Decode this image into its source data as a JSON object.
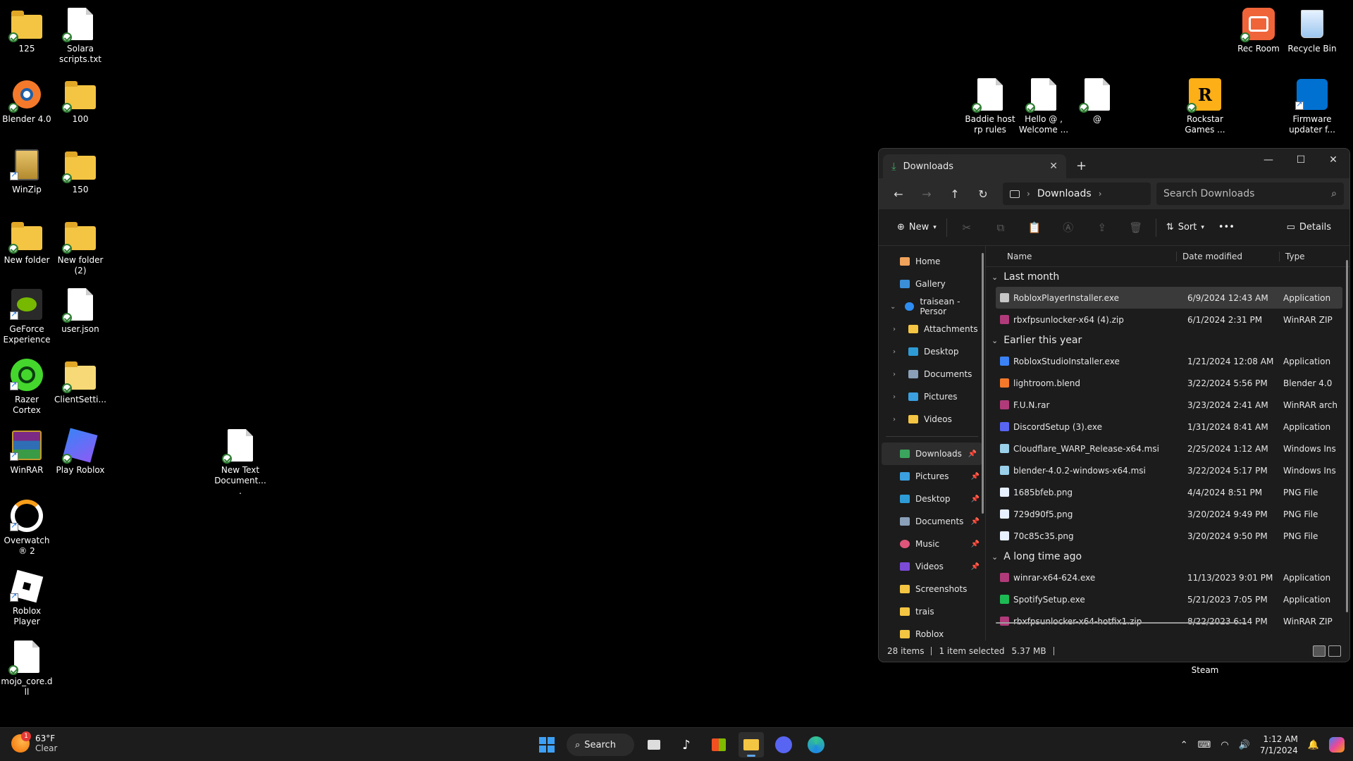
{
  "desktop": {
    "icons": {
      "i125": "125",
      "solara": "Solara scripts.txt",
      "blender": "Blender 4.0",
      "i100": "100",
      "winzip": "WinZip",
      "i150": "150",
      "newfolder": "New folder",
      "newfolder2": "New folder (2)",
      "geforce": "GeForce Experience",
      "userjson": "user.json",
      "razer": "Razer Cortex",
      "clientsetti": "ClientSetti...",
      "winrar": "WinRAR",
      "playroblox": "Play Roblox",
      "newtext": "New Text Document....",
      "overwatch": "Overwatch® 2",
      "robloxplayer": "Roblox Player",
      "mojo": "mojo_core.dll",
      "recroom": "Rec Room",
      "recycle": "Recycle Bin",
      "baddie": "Baddie host rp rules",
      "hello": "Hello @ , Welcome ...",
      "at": "@",
      "rockstar": "Rockstar Games ...",
      "firmware": "Firmware updater f...",
      "steam": "Steam"
    }
  },
  "explorer": {
    "tab_title": "Downloads",
    "breadcrumb": "Downloads",
    "search_placeholder": "Search Downloads",
    "toolbar": {
      "new": "New",
      "sort": "Sort",
      "more": "•••",
      "details": "Details"
    },
    "nav": {
      "home": "Home",
      "gallery": "Gallery",
      "onedrive": "traisean - Persor",
      "attachments": "Attachments",
      "desktop": "Desktop",
      "documents": "Documents",
      "pictures": "Pictures",
      "videos": "Videos",
      "q_downloads": "Downloads",
      "q_pictures": "Pictures",
      "q_desktop": "Desktop",
      "q_documents": "Documents",
      "q_music": "Music",
      "q_videos": "Videos",
      "q_screenshots": "Screenshots",
      "q_trais": "trais",
      "q_roblox": "Roblox"
    },
    "columns": {
      "name": "Name",
      "date": "Date modified",
      "type": "Type"
    },
    "groups": {
      "g1": "Last month",
      "g2": "Earlier this year",
      "g3": "A long time ago"
    },
    "files": [
      {
        "name": "RobloxPlayerInstaller.exe",
        "date": "6/9/2024 12:43 AM",
        "type": "Application",
        "color": "#c7c7c7"
      },
      {
        "name": "rbxfpsunlocker-x64 (4).zip",
        "date": "6/1/2024 2:31 PM",
        "type": "WinRAR ZIP",
        "color": "#b03a7a"
      },
      {
        "name": "RobloxStudioInstaller.exe",
        "date": "1/21/2024 12:08 AM",
        "type": "Application",
        "color": "#3b82f6"
      },
      {
        "name": "lightroom.blend",
        "date": "3/22/2024 5:56 PM",
        "type": "Blender 4.0",
        "color": "#f5792a"
      },
      {
        "name": "F.U.N.rar",
        "date": "3/23/2024 2:41 AM",
        "type": "WinRAR arch",
        "color": "#b03a7a"
      },
      {
        "name": "DiscordSetup (3).exe",
        "date": "1/31/2024 8:41 AM",
        "type": "Application",
        "color": "#5865f2"
      },
      {
        "name": "Cloudflare_WARP_Release-x64.msi",
        "date": "2/25/2024 1:12 AM",
        "type": "Windows Ins",
        "color": "#9ad0ea"
      },
      {
        "name": "blender-4.0.2-windows-x64.msi",
        "date": "3/22/2024 5:17 PM",
        "type": "Windows Ins",
        "color": "#9ad0ea"
      },
      {
        "name": "1685bfeb.png",
        "date": "4/4/2024 8:51 PM",
        "type": "PNG File",
        "color": "#e6f0ff"
      },
      {
        "name": "729d90f5.png",
        "date": "3/20/2024 9:49 PM",
        "type": "PNG File",
        "color": "#e6f0ff"
      },
      {
        "name": "70c85c35.png",
        "date": "3/20/2024 9:50 PM",
        "type": "PNG File",
        "color": "#e6f0ff"
      },
      {
        "name": "winrar-x64-624.exe",
        "date": "11/13/2023 9:01 PM",
        "type": "Application",
        "color": "#b03a7a"
      },
      {
        "name": "SpotifySetup.exe",
        "date": "5/21/2023 7:05 PM",
        "type": "Application",
        "color": "#1db954"
      },
      {
        "name": "rbxfpsunlocker-x64-hotfix1.zip",
        "date": "8/22/2023 6:14 PM",
        "type": "WinRAR ZIP",
        "color": "#b03a7a"
      }
    ],
    "status": {
      "items": "28 items",
      "selected": "1 item selected",
      "size": "5.37 MB"
    }
  },
  "taskbar": {
    "weather_temp": "63°F",
    "weather_cond": "Clear",
    "weather_badge": "1",
    "search_label": "Search",
    "time": "1:12 AM",
    "date": "7/1/2024"
  }
}
